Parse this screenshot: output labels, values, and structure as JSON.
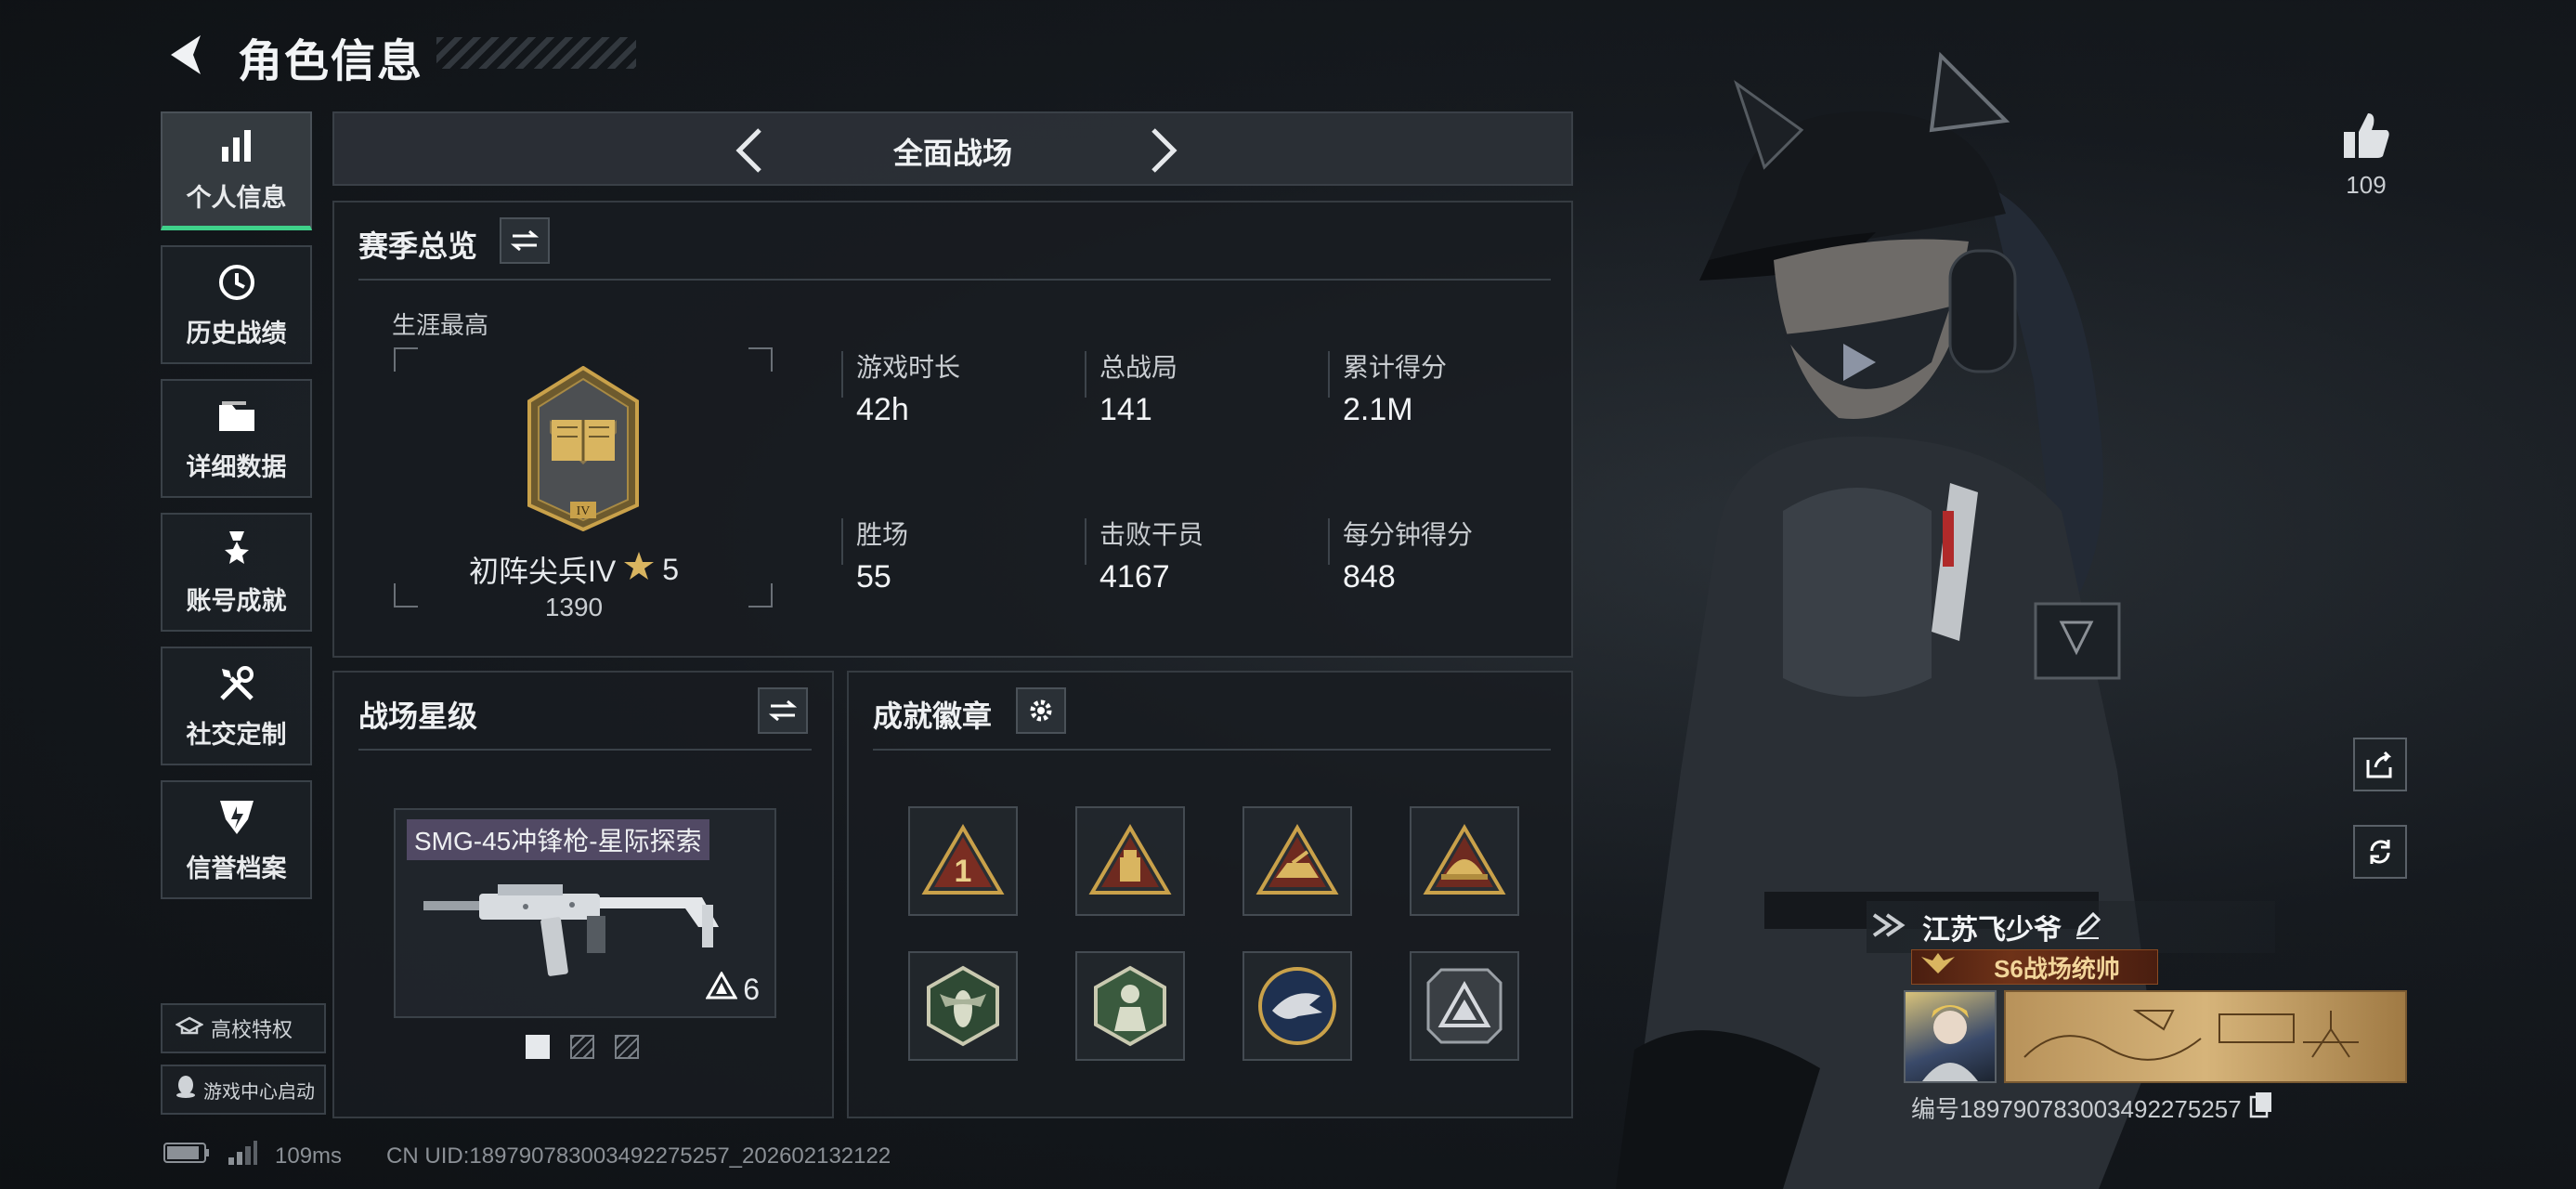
{
  "header": {
    "title": "角色信息"
  },
  "nav": {
    "items": [
      {
        "label": "个人信息",
        "icon": "bar-chart-icon"
      },
      {
        "label": "历史战绩",
        "icon": "history-clock-icon"
      },
      {
        "label": "详细数据",
        "icon": "folder-icon"
      },
      {
        "label": "账号成就",
        "icon": "achievement-medal-icon"
      },
      {
        "label": "社交定制",
        "icon": "tools-icon"
      },
      {
        "label": "信誉档案",
        "icon": "credit-shield-icon"
      }
    ],
    "extras": [
      {
        "label": "高校特权",
        "icon": "school-icon"
      },
      {
        "label": "游戏中心启动",
        "icon": "qq-penguin-icon"
      }
    ]
  },
  "mode_bar": {
    "mode": "全面战场"
  },
  "season": {
    "title": "赛季总览",
    "career_label": "生涯最高",
    "rank_name": "初阵尖兵IV",
    "rank_stars": "5",
    "rank_points": "1390",
    "rank_emblem_text": "IV",
    "stats": [
      {
        "label": "游戏时长",
        "value": "42h"
      },
      {
        "label": "总战局",
        "value": "141"
      },
      {
        "label": "累计得分",
        "value": "2.1M"
      },
      {
        "label": "胜场",
        "value": "55"
      },
      {
        "label": "击败干员",
        "value": "4167"
      },
      {
        "label": "每分钟得分",
        "value": "848"
      }
    ]
  },
  "star_level": {
    "title": "战场星级",
    "weapon_name": "SMG-45冲锋枪-星际探索",
    "weapon_level": "6",
    "pages": 3,
    "current_page": 1
  },
  "badges": {
    "title": "成就徽章",
    "items": [
      {
        "icon": "badge-rank-one-icon",
        "glyph": "1"
      },
      {
        "icon": "badge-fortress-icon",
        "glyph": ""
      },
      {
        "icon": "badge-vehicle-icon",
        "glyph": ""
      },
      {
        "icon": "badge-helmet-icon",
        "glyph": ""
      },
      {
        "icon": "badge-wasp-icon",
        "glyph": ""
      },
      {
        "icon": "badge-soldier-icon",
        "glyph": ""
      },
      {
        "icon": "badge-eagle-icon",
        "glyph": ""
      },
      {
        "icon": "badge-pyramid-icon",
        "glyph": ""
      }
    ]
  },
  "profile": {
    "likes": "109",
    "player_name": "江苏飞少爷",
    "title_tag": "S6战场统帅",
    "id_text": "编号1897907830034922752​57"
  },
  "status": {
    "ping": "109ms",
    "uid": "CN UID:1897907830034922752​57_202602132122"
  },
  "colors": {
    "accent_green": "#3fd18a",
    "gold": "#c9a14a",
    "title_tag_bg": "#5a2a14"
  }
}
